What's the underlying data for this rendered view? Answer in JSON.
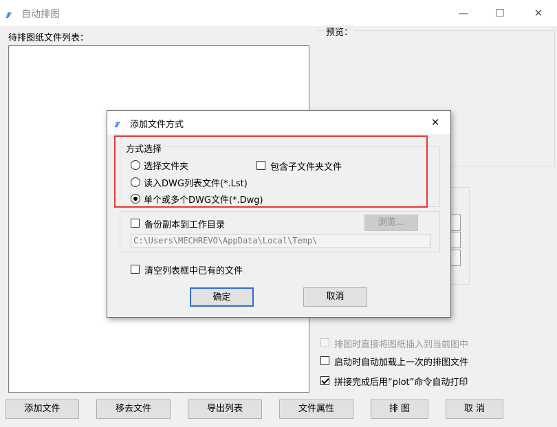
{
  "window": {
    "title": "自动排图",
    "minimize_glyph": "—",
    "maximize_glyph": "☐",
    "close_glyph": "✕"
  },
  "file_list": {
    "label": "待排图纸文件列表：",
    "items": []
  },
  "preview": {
    "label": "预览："
  },
  "options": [
    {
      "label": "排图时直接将图纸插入到当前图中",
      "checked": false,
      "enabled": false
    },
    {
      "label": "启动时自动加载上一次的排图文件",
      "checked": false,
      "enabled": true
    },
    {
      "label": "拼接完成后用“plot”命令自动打印",
      "checked": true,
      "enabled": true
    }
  ],
  "bottom_buttons": [
    {
      "label": "添加文件"
    },
    {
      "label": "移去文件"
    },
    {
      "label": "导出列表"
    },
    {
      "label": "文件属性"
    },
    {
      "label": "排 图"
    },
    {
      "label": "取 消"
    }
  ],
  "dialog": {
    "title": "添加文件方式",
    "close_glyph": "✕",
    "mode_group": {
      "label": "方式选择",
      "radio_folder": "选择文件夹",
      "include_subfolders": "包含子文件夹文件",
      "radio_list": "读入DWG列表文件(*.Lst)",
      "radio_files": "单个或多个DWG文件(*.Dwg)",
      "selected": "radio_files"
    },
    "backup_label": "备份副本到工作目录",
    "browse_label": "浏览...",
    "path_value": "C:\\Users\\MECHREVO\\AppData\\Local\\Temp\\",
    "clear_list_label": "清空列表框中已有的文件",
    "ok_label": "确定",
    "cancel_label": "取消",
    "highlight_color": "#e53935"
  },
  "colors": {
    "accent": "#2f6fd6",
    "window_bg": "#f0f0f0"
  }
}
